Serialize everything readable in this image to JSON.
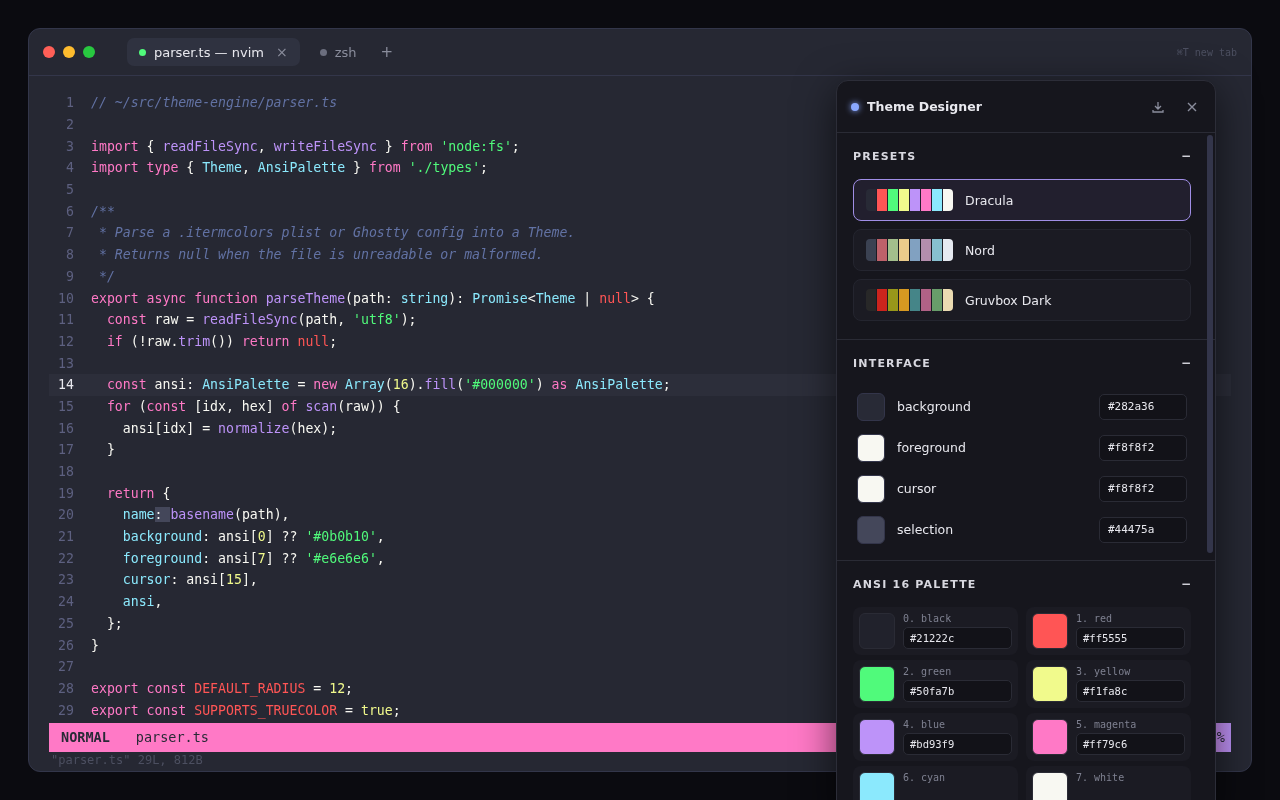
{
  "window": {
    "traffic_lights": [
      {
        "color": "#ff5f57"
      },
      {
        "color": "#febc2e"
      },
      {
        "color": "#28c840"
      }
    ],
    "tabs": [
      {
        "label": "parser.ts — nvim",
        "selected": true,
        "color": "#50fa7b",
        "close": "×"
      },
      {
        "label": "zsh",
        "selected": false,
        "color": "#6b6e7e"
      }
    ],
    "new_tab": "+",
    "hint": "⌘T new tab"
  },
  "editor": {
    "lines": [
      {
        "n": "1",
        "current": false,
        "tokens": [
          {
            "t": "// ~/src/theme-engine/parser.ts",
            "kind": "comment"
          }
        ]
      },
      {
        "n": "2",
        "current": false
      },
      {
        "n": "3",
        "current": false,
        "tokens": [
          {
            "t": "import",
            "kind": "kw"
          },
          {
            "t": " { ",
            "kind": "p"
          },
          {
            "t": "readFileSync",
            "kind": "fn"
          },
          {
            "t": ", ",
            "kind": "p"
          },
          {
            "t": "writeFileSync",
            "kind": "fn"
          },
          {
            "t": " } ",
            "kind": "p"
          },
          {
            "t": "from ",
            "kind": "kw"
          },
          {
            "t": "'node:fs'",
            "kind": "str"
          },
          {
            "t": ";",
            "kind": "p"
          }
        ]
      },
      {
        "n": "4",
        "current": false,
        "tokens": [
          {
            "t": "import ",
            "kind": "kw"
          },
          {
            "t": "type",
            "kind": "kw"
          },
          {
            "t": " { ",
            "kind": "p"
          },
          {
            "t": "Theme",
            "kind": "type"
          },
          {
            "t": ", ",
            "kind": "p"
          },
          {
            "t": "AnsiPalette",
            "kind": "type"
          },
          {
            "t": " } ",
            "kind": "p"
          },
          {
            "t": "from ",
            "kind": "kw"
          },
          {
            "t": "'./types'",
            "kind": "str"
          },
          {
            "t": ";",
            "kind": "p"
          }
        ]
      },
      {
        "n": "5",
        "current": false
      },
      {
        "n": "6",
        "current": false,
        "tokens": [
          {
            "t": "/**",
            "kind": "comment"
          }
        ]
      },
      {
        "n": "7",
        "current": false,
        "tokens": [
          {
            "t": " * Parse a .itermcolors plist or Ghostty config into a Theme.",
            "kind": "comment"
          }
        ]
      },
      {
        "n": "8",
        "current": false,
        "tokens": [
          {
            "t": " * Returns null when the file is unreadable or malformed.",
            "kind": "comment"
          }
        ]
      },
      {
        "n": "9",
        "current": false,
        "tokens": [
          {
            "t": " */",
            "kind": "comment"
          }
        ]
      },
      {
        "n": "10",
        "current": false,
        "tokens": [
          {
            "t": "export async function ",
            "kind": "kw"
          },
          {
            "t": "parseTheme",
            "kind": "fn"
          },
          {
            "t": "(path: ",
            "kind": "p"
          },
          {
            "t": "string",
            "kind": "type"
          },
          {
            "t": "): ",
            "kind": "p"
          },
          {
            "t": "Promise",
            "kind": "type"
          },
          {
            "t": "<",
            "kind": "p"
          },
          {
            "t": "Theme",
            "kind": "type"
          },
          {
            "t": " | ",
            "kind": "p"
          },
          {
            "t": "null",
            "kind": "red"
          },
          {
            "t": "> {",
            "kind": "p"
          }
        ]
      },
      {
        "n": "11",
        "current": false,
        "tokens": [
          {
            "t": "  const",
            "kind": "kw"
          },
          {
            "t": " raw = ",
            "kind": "p"
          },
          {
            "t": "readFileSync",
            "kind": "fn"
          },
          {
            "t": "(path, ",
            "kind": "p"
          },
          {
            "t": "'utf8'",
            "kind": "str"
          },
          {
            "t": ");",
            "kind": "p"
          }
        ]
      },
      {
        "n": "12",
        "current": false,
        "tokens": [
          {
            "t": "  if",
            "kind": "kw"
          },
          {
            "t": " (!raw.",
            "kind": "p"
          },
          {
            "t": "trim",
            "kind": "fn"
          },
          {
            "t": "()) ",
            "kind": "p"
          },
          {
            "t": "return ",
            "kind": "kw"
          },
          {
            "t": "null",
            "kind": "red"
          },
          {
            "t": ";",
            "kind": "p"
          }
        ]
      },
      {
        "n": "13",
        "current": false
      },
      {
        "n": "14",
        "current": true,
        "tokens": [
          {
            "t": "  const",
            "kind": "kw"
          },
          {
            "t": " ansi: ",
            "kind": "p"
          },
          {
            "t": "AnsiPalette",
            "kind": "type"
          },
          {
            "t": " = ",
            "kind": "p"
          },
          {
            "t": "new ",
            "kind": "kw"
          },
          {
            "t": "Array",
            "kind": "type"
          },
          {
            "t": "(",
            "kind": "p"
          },
          {
            "t": "16",
            "kind": "num"
          },
          {
            "t": ").",
            "kind": "p"
          },
          {
            "t": "fill",
            "kind": "fn"
          },
          {
            "t": "(",
            "kind": "p"
          },
          {
            "t": "'#000000'",
            "kind": "str"
          },
          {
            "t": ") ",
            "kind": "p"
          },
          {
            "t": "as ",
            "kind": "kw"
          },
          {
            "t": "AnsiPalette",
            "kind": "type"
          },
          {
            "t": ";",
            "kind": "p"
          }
        ]
      },
      {
        "n": "15",
        "current": false,
        "tokens": [
          {
            "t": "  for",
            "kind": "kw"
          },
          {
            "t": " (",
            "kind": "p"
          },
          {
            "t": "const",
            "kind": "kw"
          },
          {
            "t": " [idx, hex] ",
            "kind": "p"
          },
          {
            "t": "of ",
            "kind": "kw"
          },
          {
            "t": "scan",
            "kind": "fn"
          },
          {
            "t": "(raw)) {",
            "kind": "p"
          }
        ]
      },
      {
        "n": "16",
        "current": false,
        "tokens": [
          {
            "t": "    ansi[idx] = ",
            "kind": "p"
          },
          {
            "t": "normalize",
            "kind": "fn"
          },
          {
            "t": "(hex);",
            "kind": "p"
          }
        ]
      },
      {
        "n": "17",
        "current": false,
        "tokens": [
          {
            "t": "  }",
            "kind": "p"
          }
        ]
      },
      {
        "n": "18",
        "current": false
      },
      {
        "n": "19",
        "current": false,
        "tokens": [
          {
            "t": "  return",
            "kind": "kw"
          },
          {
            "t": " {",
            "kind": "p"
          }
        ]
      },
      {
        "n": "20",
        "current": false,
        "tokens": [
          {
            "t": "    name",
            "kind": "type"
          },
          {
            "t": ": ",
            "kind": "sel"
          },
          {
            "t": "basename",
            "kind": "fn"
          },
          {
            "t": "(path),",
            "kind": "p"
          }
        ]
      },
      {
        "n": "21",
        "current": false,
        "tokens": [
          {
            "t": "    background",
            "kind": "type"
          },
          {
            "t": ": ansi[",
            "kind": "p"
          },
          {
            "t": "0",
            "kind": "num"
          },
          {
            "t": "] ?? ",
            "kind": "p"
          },
          {
            "t": "'#0b0b10'",
            "kind": "str"
          },
          {
            "t": ",",
            "kind": "p"
          }
        ]
      },
      {
        "n": "22",
        "current": false,
        "tokens": [
          {
            "t": "    foreground",
            "kind": "type"
          },
          {
            "t": ": ansi[",
            "kind": "p"
          },
          {
            "t": "7",
            "kind": "num"
          },
          {
            "t": "] ?? ",
            "kind": "p"
          },
          {
            "t": "'#e6e6e6'",
            "kind": "str"
          },
          {
            "t": ",",
            "kind": "p"
          }
        ]
      },
      {
        "n": "23",
        "current": false,
        "tokens": [
          {
            "t": "    cursor",
            "kind": "type"
          },
          {
            "t": ": ansi[",
            "kind": "p"
          },
          {
            "t": "15",
            "kind": "num"
          },
          {
            "t": "],",
            "kind": "p"
          }
        ]
      },
      {
        "n": "24",
        "current": false,
        "tokens": [
          {
            "t": "    ansi",
            "kind": "type"
          },
          {
            "t": ",",
            "kind": "p"
          }
        ]
      },
      {
        "n": "25",
        "current": false,
        "tokens": [
          {
            "t": "  };",
            "kind": "p"
          }
        ]
      },
      {
        "n": "26",
        "current": false,
        "tokens": [
          {
            "t": "}",
            "kind": "p"
          }
        ]
      },
      {
        "n": "27",
        "current": false
      },
      {
        "n": "28",
        "current": false,
        "tokens": [
          {
            "t": "export const ",
            "kind": "kw"
          },
          {
            "t": "DEFAULT_RADIUS",
            "kind": "red"
          },
          {
            "t": " = ",
            "kind": "p"
          },
          {
            "t": "12",
            "kind": "num"
          },
          {
            "t": ";",
            "kind": "p"
          }
        ]
      },
      {
        "n": "29",
        "current": false,
        "tokens": [
          {
            "t": "export const ",
            "kind": "kw"
          },
          {
            "t": "SUPPORTS_TRUECOLOR",
            "kind": "red"
          },
          {
            "t": " = ",
            "kind": "p"
          },
          {
            "t": "true",
            "kind": "num"
          },
          {
            "t": ";",
            "kind": "p"
          }
        ]
      }
    ]
  },
  "status_bar": {
    "mode": "NORMAL",
    "file": "parser.ts",
    "right": "%"
  },
  "message": "\"parser.ts\" 29L, 812B",
  "panel": {
    "title": "Theme Designer",
    "title_dot": {
      "color": "#8aa8ff"
    },
    "presets": {
      "heading": "PRESETS",
      "toggle": "−",
      "items": [
        {
          "name": "Dracula",
          "selected": true,
          "swatches": [
            {
              "color": "#282a36"
            },
            {
              "color": "#ff5555"
            },
            {
              "color": "#50fa7b"
            },
            {
              "color": "#f1fa8c"
            },
            {
              "color": "#bd93f9"
            },
            {
              "color": "#ff79c6"
            },
            {
              "color": "#8be9fd"
            },
            {
              "color": "#f8f8f2"
            }
          ]
        },
        {
          "name": "Nord",
          "selected": false,
          "swatches": [
            {
              "color": "#3b4252"
            },
            {
              "color": "#bf616a"
            },
            {
              "color": "#a3be8c"
            },
            {
              "color": "#ebcb8b"
            },
            {
              "color": "#81a1c1"
            },
            {
              "color": "#b48ead"
            },
            {
              "color": "#88c0d0"
            },
            {
              "color": "#e5e9f0"
            }
          ]
        },
        {
          "name": "Gruvbox Dark",
          "selected": false,
          "swatches": [
            {
              "color": "#282828"
            },
            {
              "color": "#cc241d"
            },
            {
              "color": "#98971a"
            },
            {
              "color": "#d79921"
            },
            {
              "color": "#458588"
            },
            {
              "color": "#b16286"
            },
            {
              "color": "#689d6a"
            },
            {
              "color": "#ebdbb2"
            }
          ]
        }
      ]
    },
    "interface": {
      "heading": "INTERFACE",
      "toggle": "−",
      "rows": [
        {
          "label": "background",
          "hex": "#282a36",
          "color": "#282a36"
        },
        {
          "label": "foreground",
          "hex": "#f8f8f2",
          "color": "#f8f8f2"
        },
        {
          "label": "cursor",
          "hex": "#f8f8f2",
          "color": "#f8f8f2"
        },
        {
          "label": "selection",
          "hex": "#44475a",
          "color": "#44475a"
        }
      ]
    },
    "palette": {
      "heading": "ANSI 16 PALETTE",
      "toggle": "−",
      "colors": [
        {
          "label": "0. black",
          "hex": "#21222c",
          "color": "#21222c"
        },
        {
          "label": "1. red",
          "hex": "#ff5555",
          "color": "#ff5555"
        },
        {
          "label": "2. green",
          "hex": "#50fa7b",
          "color": "#50fa7b"
        },
        {
          "label": "3. yellow",
          "hex": "#f1fa8c",
          "color": "#f1fa8c"
        },
        {
          "label": "4. blue",
          "hex": "#bd93f9",
          "color": "#bd93f9"
        },
        {
          "label": "5. magenta",
          "hex": "#ff79c6",
          "color": "#ff79c6"
        },
        {
          "label": "6. cyan",
          "color": "#8be9fd"
        },
        {
          "label": "7. white",
          "color": "#f8f8f2"
        }
      ]
    }
  }
}
